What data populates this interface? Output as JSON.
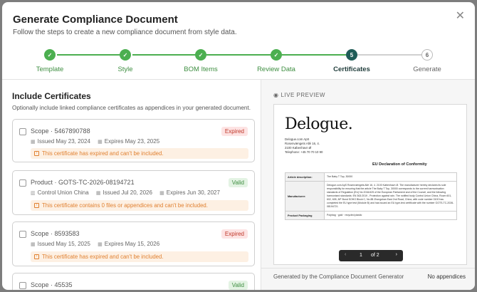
{
  "modal": {
    "title": "Generate Compliance Document",
    "subtitle": "Follow the steps to create a new compliance document from style data.",
    "close_icon": "close-icon"
  },
  "steps": [
    {
      "label": "Template",
      "status": "done",
      "mark": "✓"
    },
    {
      "label": "Style",
      "status": "done",
      "mark": "✓"
    },
    {
      "label": "BOM Items",
      "status": "done",
      "mark": "✓"
    },
    {
      "label": "Review Data",
      "status": "done",
      "mark": "✓"
    },
    {
      "label": "Certificates",
      "status": "active",
      "mark": "5"
    },
    {
      "label": "Generate",
      "status": "todo",
      "mark": "6"
    }
  ],
  "certificates": {
    "title": "Include Certificates",
    "subtitle": "Optionally include linked compliance certificates as appendices in your generated document.",
    "items": [
      {
        "title": "Scope · 5467890788",
        "badge": "Expired",
        "issuer": "",
        "issued": "Issued May 23, 2024",
        "expires": "Expires May 23, 2025",
        "warning": "This certificate has expired and can't be included."
      },
      {
        "title": "Product · GOTS-TC-2026-08194721",
        "badge": "Valid",
        "issuer": "Control Union China",
        "issued": "Issued Jul 20, 2026",
        "expires": "Expires Jun 30, 2027",
        "warning": "This certificate contains 0 files or appendices and can't be included."
      },
      {
        "title": "Scope · 8593583",
        "badge": "Expired",
        "issuer": "",
        "issued": "Issued May 15, 2025",
        "expires": "Expires May 15, 2026",
        "warning": "This certificate has expired and can't be included."
      },
      {
        "title": "Scope · 45535",
        "badge": "Valid",
        "issuer": "",
        "issued": "",
        "expires": "",
        "warning": ""
      }
    ]
  },
  "preview": {
    "label": "LIVE PREVIEW",
    "logo": "Delogue.",
    "address": [
      "Delogue.com ApS",
      "Rosenvængets Allé 16, 4.",
      "2100 København Ø",
      "Telephone: +45 70 70 10 90"
    ],
    "doc_title": "EU Declaration of Conformity",
    "rows": [
      {
        "key": "Article description:",
        "value": "The Baby T Top, 30000"
      },
      {
        "key": "Manufacturer:",
        "value": "Delogue.com ApS Rosenvængets Allé 16, 4. 2100 København Ø. The manufacturer hereby declares its sole responsibility for ensuring that the article The Baby T Top, 30000 corresponds to the current harmonisation standards of Regulation (EU) No 2016/425 of the European Parliament and of the Council, and the following harmonised standards: EN 363:2019 - Protection against rain. The notified body Control Union China, Room 601, 602, 605, 8/F Bund SOHO Block C, No.88 Zhongshan East 2nd Road, China, with code number 0100 has completed the EU type test (Module B) and has issued an EU type-test certificate with the number GOTS-TC-2026-08194721."
      },
      {
        "key": "Product Packaging",
        "value": "Polybag · gold · recycled plastic"
      }
    ],
    "page_current": "1",
    "page_total": "of 2",
    "prev_icon": "chevron-left-icon",
    "next_icon": "chevron-right-icon"
  },
  "footer": {
    "left": "Generated by the Compliance Document Generator",
    "right": "No appendices"
  },
  "colors": {
    "success": "#4caf50",
    "active": "#1f5c57",
    "danger": "#c0392b",
    "warning": "#e08030"
  }
}
